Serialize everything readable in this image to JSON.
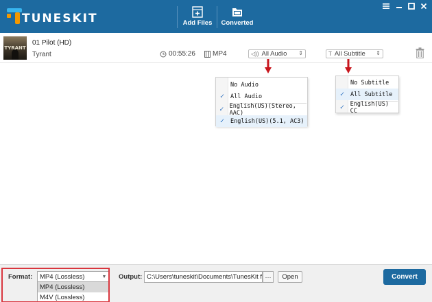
{
  "app": {
    "logo_text": "TUNESKIT",
    "toolbar": {
      "add_files_label": "Add Files",
      "converted_label": "Converted"
    },
    "window_controls": [
      "menu-icon",
      "minimize-icon",
      "maximize-icon",
      "close-icon"
    ]
  },
  "video": {
    "thumbnail_text": "TYRANT",
    "title": "01 Pilot (HD)",
    "subtitle": "Tyrant",
    "duration": "00:55:26",
    "format": "MP4",
    "audio_selected": "All Audio",
    "subtitle_selected": "All Subtitle"
  },
  "audio_popup": {
    "items": [
      {
        "label": "No Audio",
        "checked": false
      },
      {
        "label": "All Audio",
        "checked": true
      },
      {
        "label": "English(US)(Stereo, AAC)",
        "checked": true
      },
      {
        "label": "English(US)(5.1, AC3)",
        "checked": true
      }
    ]
  },
  "subtitle_popup": {
    "items": [
      {
        "label": "No Subtitle",
        "checked": false
      },
      {
        "label": "All Subtitle",
        "checked": true
      },
      {
        "label": "English(US) CC",
        "checked": true
      }
    ]
  },
  "bottom": {
    "format_label": "Format:",
    "format_value": "MP4 (Lossless)",
    "format_options": [
      "MP4 (Lossless)",
      "M4V (Lossless)"
    ],
    "output_label": "Output:",
    "output_path": "C:\\Users\\tuneskit\\Documents\\TunesKit for i",
    "browse_label": "···",
    "open_label": "Open",
    "convert_label": "Convert"
  },
  "colors": {
    "titlebar": "#1d6aa0",
    "accent_blue": "#37b5ef",
    "accent_orange": "#f39800",
    "highlight_red": "#d9363e",
    "check_blue": "#2a6fc0"
  }
}
